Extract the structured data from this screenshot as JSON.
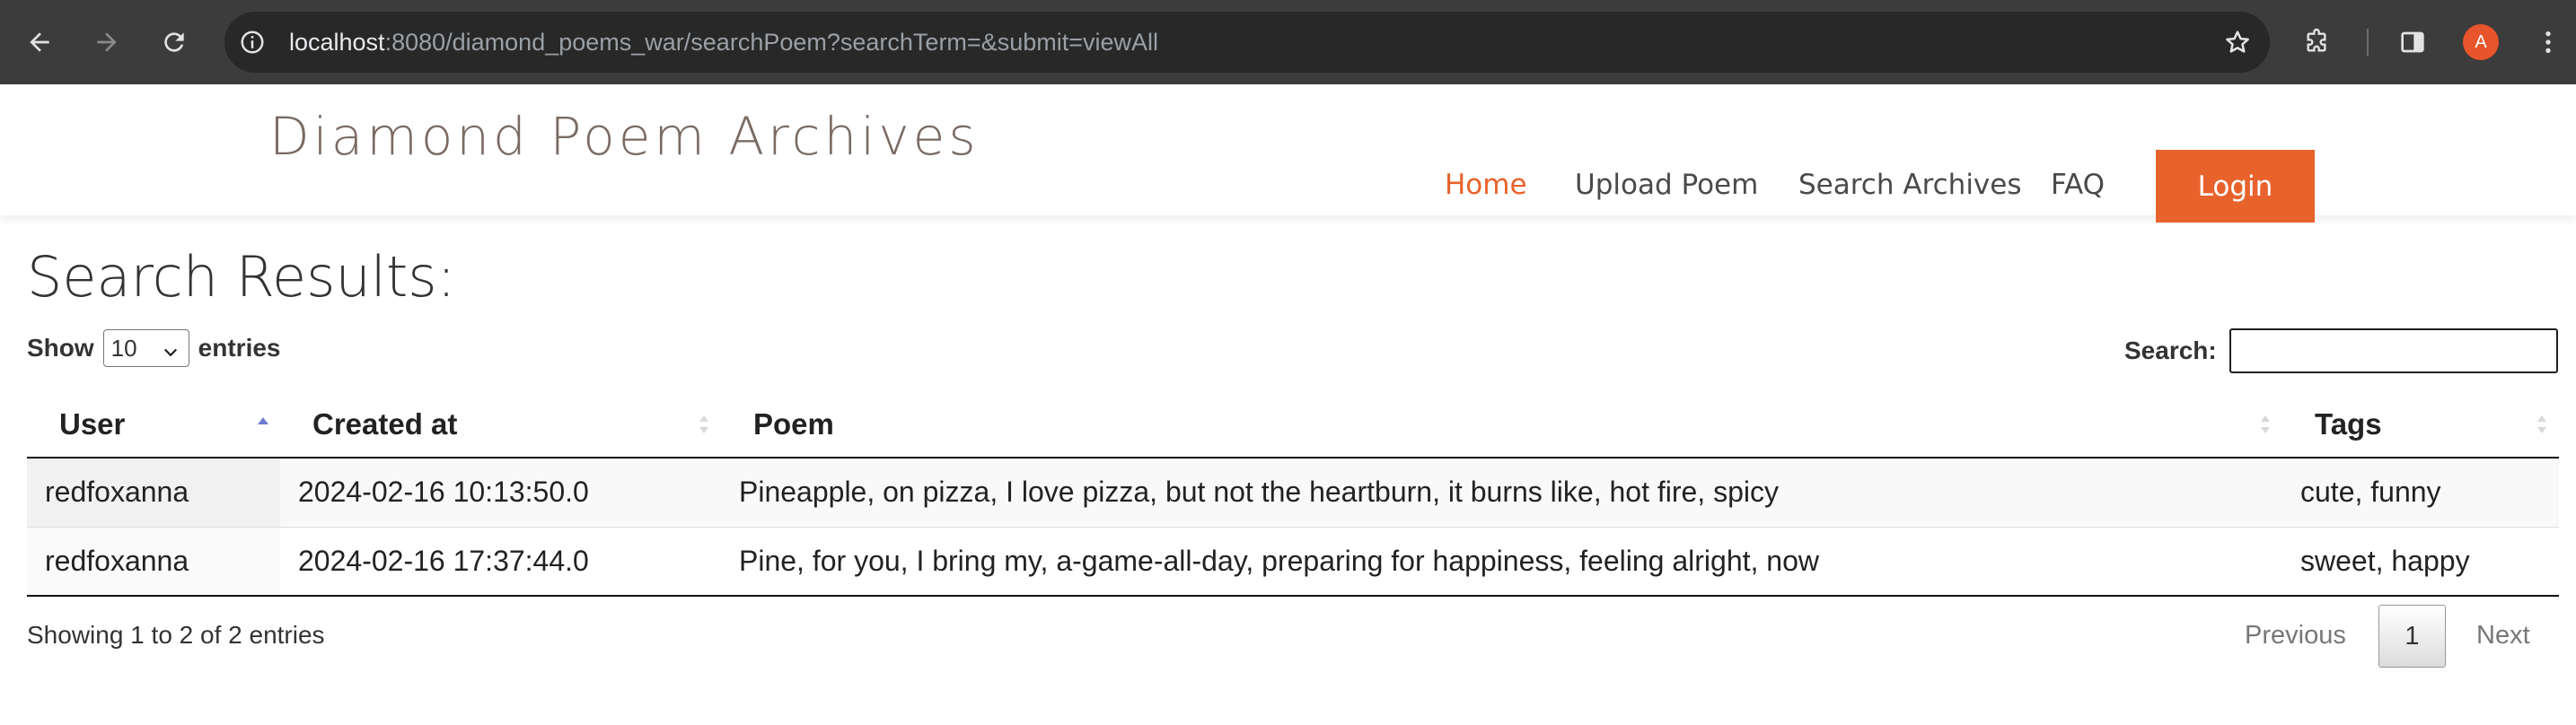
{
  "browser": {
    "url_host": "localhost",
    "url_rest": ":8080/diamond_poems_war/searchPoem?searchTerm=&submit=viewAll",
    "profile_initial": "A",
    "icons": [
      "back-arrow-icon",
      "forward-arrow-icon",
      "reload-icon",
      "site-info-icon",
      "star-icon",
      "extensions-icon",
      "side-panel-icon",
      "kebab-menu-icon"
    ]
  },
  "site": {
    "brand": "Diamond Poem Archives",
    "accent_color": "#e8622c",
    "nav": [
      {
        "label": "Home",
        "active": true
      },
      {
        "label": "Upload Poem",
        "active": false
      },
      {
        "label": "Search Archives",
        "active": false
      },
      {
        "label": "FAQ",
        "active": false
      }
    ],
    "login_label": "Login"
  },
  "main": {
    "title": "Search Results:",
    "length": {
      "prefix": "Show",
      "value": "10",
      "suffix": "entries"
    },
    "search": {
      "label": "Search:",
      "value": ""
    },
    "table": {
      "columns": [
        "User",
        "Created at",
        "Poem",
        "Tags"
      ],
      "sorted_column": "User",
      "sort_direction": "ascending",
      "rows": [
        {
          "user": "redfoxanna",
          "created_at": "2024-02-16 10:13:50.0",
          "poem": "Pineapple, on pizza, I love pizza, but not the heartburn, it burns like, hot fire, spicy",
          "tags": "cute, funny"
        },
        {
          "user": "redfoxanna",
          "created_at": "2024-02-16 17:37:44.0",
          "poem": "Pine, for you, I bring my, a-game-all-day, preparing for happiness, feeling alright, now",
          "tags": "sweet, happy"
        }
      ]
    },
    "info": "Showing 1 to 2 of 2 entries",
    "pager": {
      "previous": "Previous",
      "current": "1",
      "next": "Next"
    }
  }
}
